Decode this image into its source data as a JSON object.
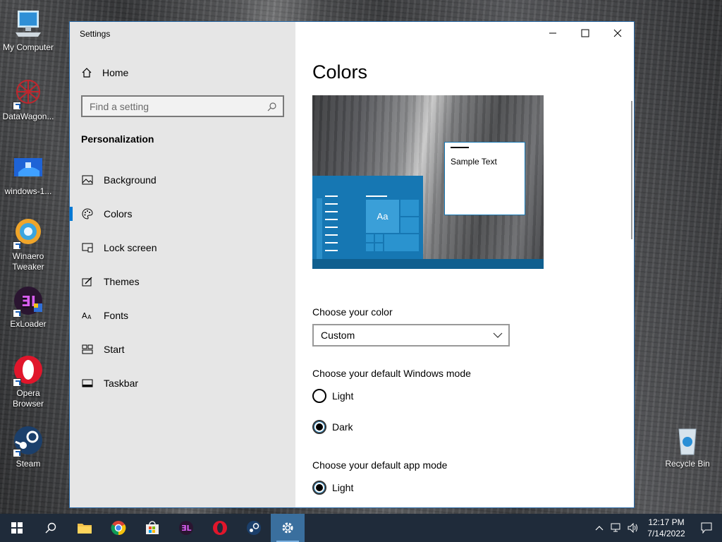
{
  "desktop": {
    "icons": [
      {
        "label": "My Computer"
      },
      {
        "label": "DataWagon..."
      },
      {
        "label": "windows-1..."
      },
      {
        "label": "Winaero Tweaker"
      },
      {
        "label": "ExLoader"
      },
      {
        "label": "Opera Browser"
      },
      {
        "label": "Steam"
      },
      {
        "label": "Recycle Bin"
      }
    ]
  },
  "window": {
    "title": "Settings",
    "controls": {
      "minimize": "minimize-icon",
      "maximize": "maximize-icon",
      "close": "close-icon"
    }
  },
  "sidebar": {
    "home_label": "Home",
    "search_placeholder": "Find a setting",
    "section_title": "Personalization",
    "items": [
      {
        "label": "Background",
        "icon": "picture-icon"
      },
      {
        "label": "Colors",
        "icon": "palette-icon",
        "active": true
      },
      {
        "label": "Lock screen",
        "icon": "lock-screen-icon"
      },
      {
        "label": "Themes",
        "icon": "themes-icon"
      },
      {
        "label": "Fonts",
        "icon": "fonts-icon"
      },
      {
        "label": "Start",
        "icon": "start-icon"
      },
      {
        "label": "Taskbar",
        "icon": "taskbar-icon"
      }
    ]
  },
  "main": {
    "title": "Colors",
    "preview": {
      "tile_label": "Aa",
      "sample_text": "Sample Text"
    },
    "choose_color_label": "Choose your color",
    "choose_color_value": "Custom",
    "windows_mode_label": "Choose your default Windows mode",
    "windows_mode_options": [
      {
        "label": "Light",
        "selected": false
      },
      {
        "label": "Dark",
        "selected": true
      }
    ],
    "app_mode_label": "Choose your default app mode",
    "app_mode_options": [
      {
        "label": "Light",
        "selected": true
      }
    ]
  },
  "taskbar": {
    "time": "12:17 PM",
    "date": "7/14/2022",
    "accent": "#1f2b3a"
  }
}
